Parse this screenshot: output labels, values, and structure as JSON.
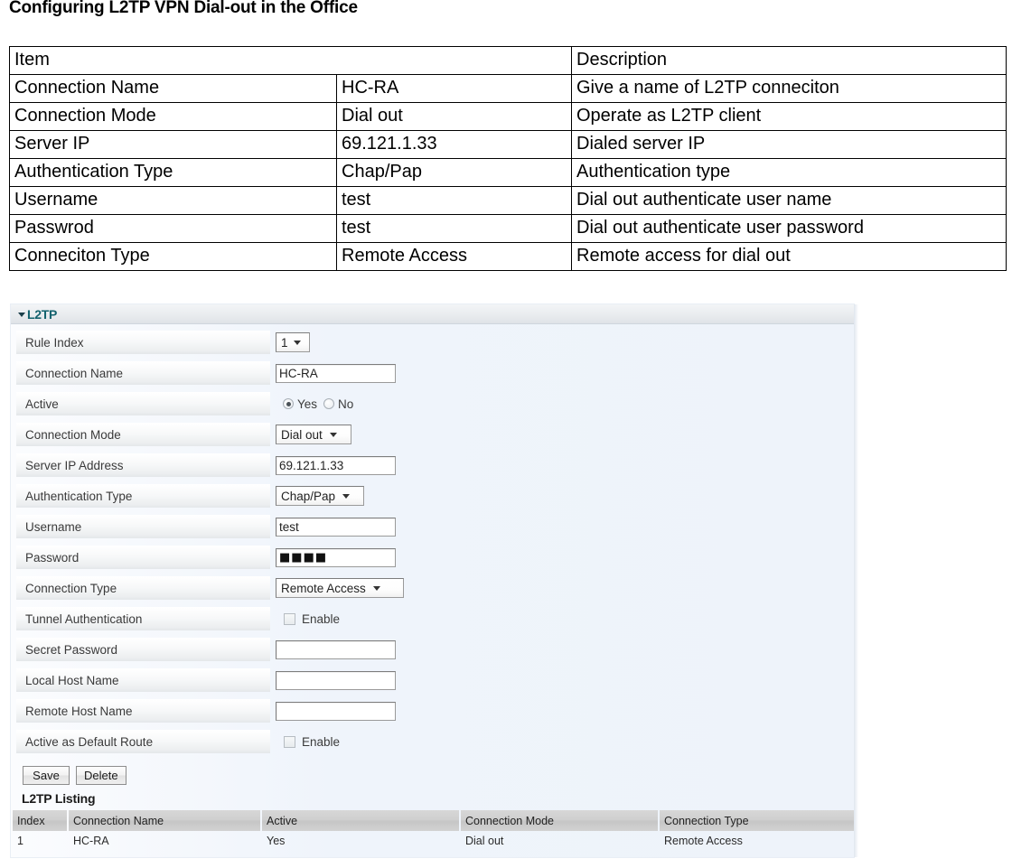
{
  "document": {
    "title": "Configuring L2TP VPN Dial-out in the Office"
  },
  "spec_table": {
    "headers": [
      "Item",
      "Description"
    ],
    "rows": [
      {
        "item": "Connection Name",
        "value": "HC-RA",
        "description": "Give a name of L2TP conneciton"
      },
      {
        "item": "Connection Mode",
        "value": "Dial out",
        "description": "Operate as L2TP client"
      },
      {
        "item": "Server IP",
        "value": "69.121.1.33",
        "description": "Dialed server IP"
      },
      {
        "item": "Authentication Type",
        "value": "Chap/Pap",
        "description": "Authentication type"
      },
      {
        "item": "Username",
        "value": "test",
        "description": "Dial out authenticate user name"
      },
      {
        "item": "Passwrod",
        "value": "test",
        "description": "Dial out authenticate user password"
      },
      {
        "item": "Conneciton Type",
        "value": "Remote Access",
        "description": "Remote access for dial out"
      }
    ]
  },
  "panel": {
    "title": "L2TP",
    "accent_color": "#13626e",
    "fields": {
      "rule_index": {
        "label": "Rule Index",
        "value": "1"
      },
      "connection_name": {
        "label": "Connection Name",
        "value": "HC-RA"
      },
      "active": {
        "label": "Active",
        "yes": "Yes",
        "no": "No",
        "selected": "Yes"
      },
      "connection_mode": {
        "label": "Connection Mode",
        "value": "Dial out"
      },
      "server_ip": {
        "label": "Server IP Address",
        "value": "69.121.1.33"
      },
      "authentication_type": {
        "label": "Authentication Type",
        "value": "Chap/Pap"
      },
      "username": {
        "label": "Username",
        "value": "test"
      },
      "password": {
        "label": "Password",
        "value": "■■■■"
      },
      "connection_type": {
        "label": "Connection Type",
        "value": "Remote Access"
      },
      "tunnel_auth": {
        "label": "Tunnel Authentication",
        "enable_label": "Enable",
        "checked": false
      },
      "secret_password": {
        "label": "Secret Password",
        "value": ""
      },
      "local_host_name": {
        "label": "Local Host Name",
        "value": ""
      },
      "remote_host_name": {
        "label": "Remote Host Name",
        "value": ""
      },
      "default_route": {
        "label": "Active as Default Route",
        "enable_label": "Enable",
        "checked": false
      }
    },
    "buttons": {
      "save": "Save",
      "delete": "Delete"
    },
    "listing": {
      "title": "L2TP Listing",
      "headers": [
        "Index",
        "Connection Name",
        "Active",
        "Connection Mode",
        "Connection Type"
      ],
      "rows": [
        {
          "index": "1",
          "name": "HC-RA",
          "active": "Yes",
          "mode": "Dial out",
          "type": "Remote Access"
        }
      ]
    }
  }
}
